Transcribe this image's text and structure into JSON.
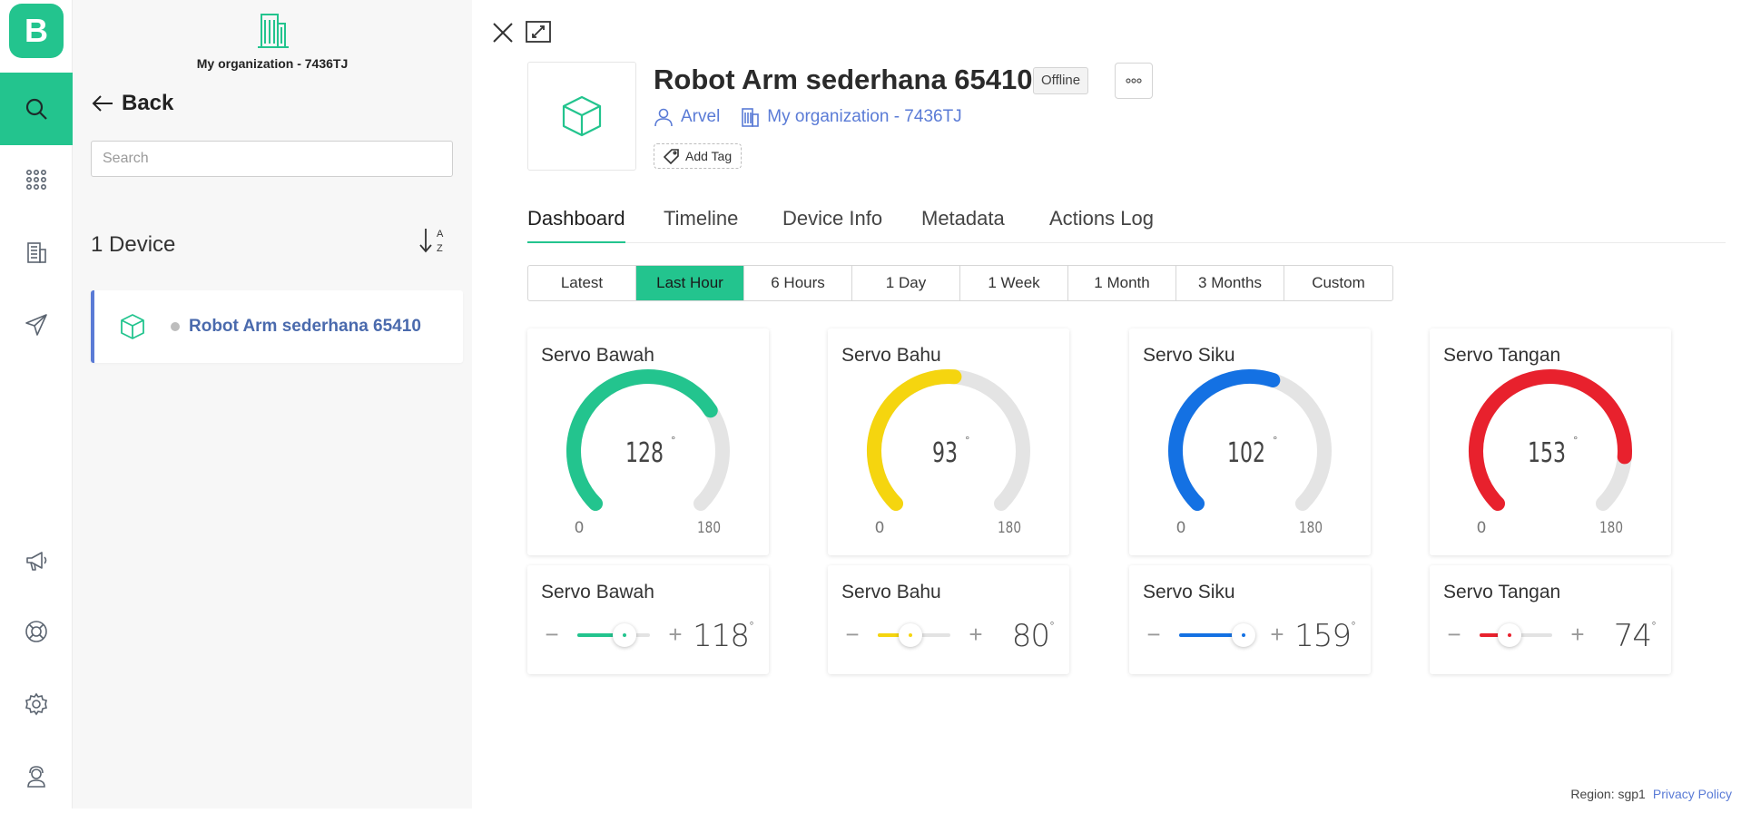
{
  "rail": {
    "logo_letter": "B",
    "items": [
      "search-icon",
      "grid-icon",
      "building-icon",
      "send-icon",
      "megaphone-icon",
      "lifebuoy-icon",
      "gear-icon",
      "user-support-icon"
    ]
  },
  "panel": {
    "org_name": "My organization - 7436TJ",
    "back_label": "Back",
    "search_placeholder": "Search",
    "device_count": "1 Device",
    "devices": [
      {
        "name": "Robot Arm sederhana 65410"
      }
    ]
  },
  "device": {
    "title": "Robot Arm sederhana 65410",
    "status": "Offline",
    "owner": "Arvel",
    "organization": "My organization - 7436TJ",
    "add_tag_label": "Add Tag"
  },
  "tabs": [
    "Dashboard",
    "Timeline",
    "Device Info",
    "Metadata",
    "Actions Log"
  ],
  "active_tab": "Dashboard",
  "time_ranges": [
    "Latest",
    "Last Hour",
    "6 Hours",
    "1 Day",
    "1 Week",
    "1 Month",
    "3 Months",
    "Custom"
  ],
  "active_range": "Last Hour",
  "gauges": [
    {
      "title": "Servo Bawah",
      "value": 128,
      "min": 0,
      "max": 180,
      "unit": "°",
      "color": "#23c48e"
    },
    {
      "title": "Servo Bahu",
      "value": 93,
      "min": 0,
      "max": 180,
      "unit": "°",
      "color": "#f5d50f"
    },
    {
      "title": "Servo Siku",
      "value": 102,
      "min": 0,
      "max": 180,
      "unit": "°",
      "color": "#1471e3"
    },
    {
      "title": "Servo Tangan",
      "value": 153,
      "min": 0,
      "max": 180,
      "unit": "°",
      "color": "#e8212d"
    }
  ],
  "sliders": [
    {
      "title": "Servo Bawah",
      "value": 118,
      "min": 0,
      "max": 180,
      "unit": "°",
      "color": "#23c48e"
    },
    {
      "title": "Servo Bahu",
      "value": 80,
      "min": 0,
      "max": 180,
      "unit": "°",
      "color": "#f5d50f"
    },
    {
      "title": "Servo Siku",
      "value": 159,
      "min": 0,
      "max": 180,
      "unit": "°",
      "color": "#1471e3"
    },
    {
      "title": "Servo Tangan",
      "value": 74,
      "min": 0,
      "max": 180,
      "unit": "°",
      "color": "#e8212d"
    }
  ],
  "footer": {
    "region": "Region: sgp1",
    "privacy": "Privacy Policy"
  }
}
